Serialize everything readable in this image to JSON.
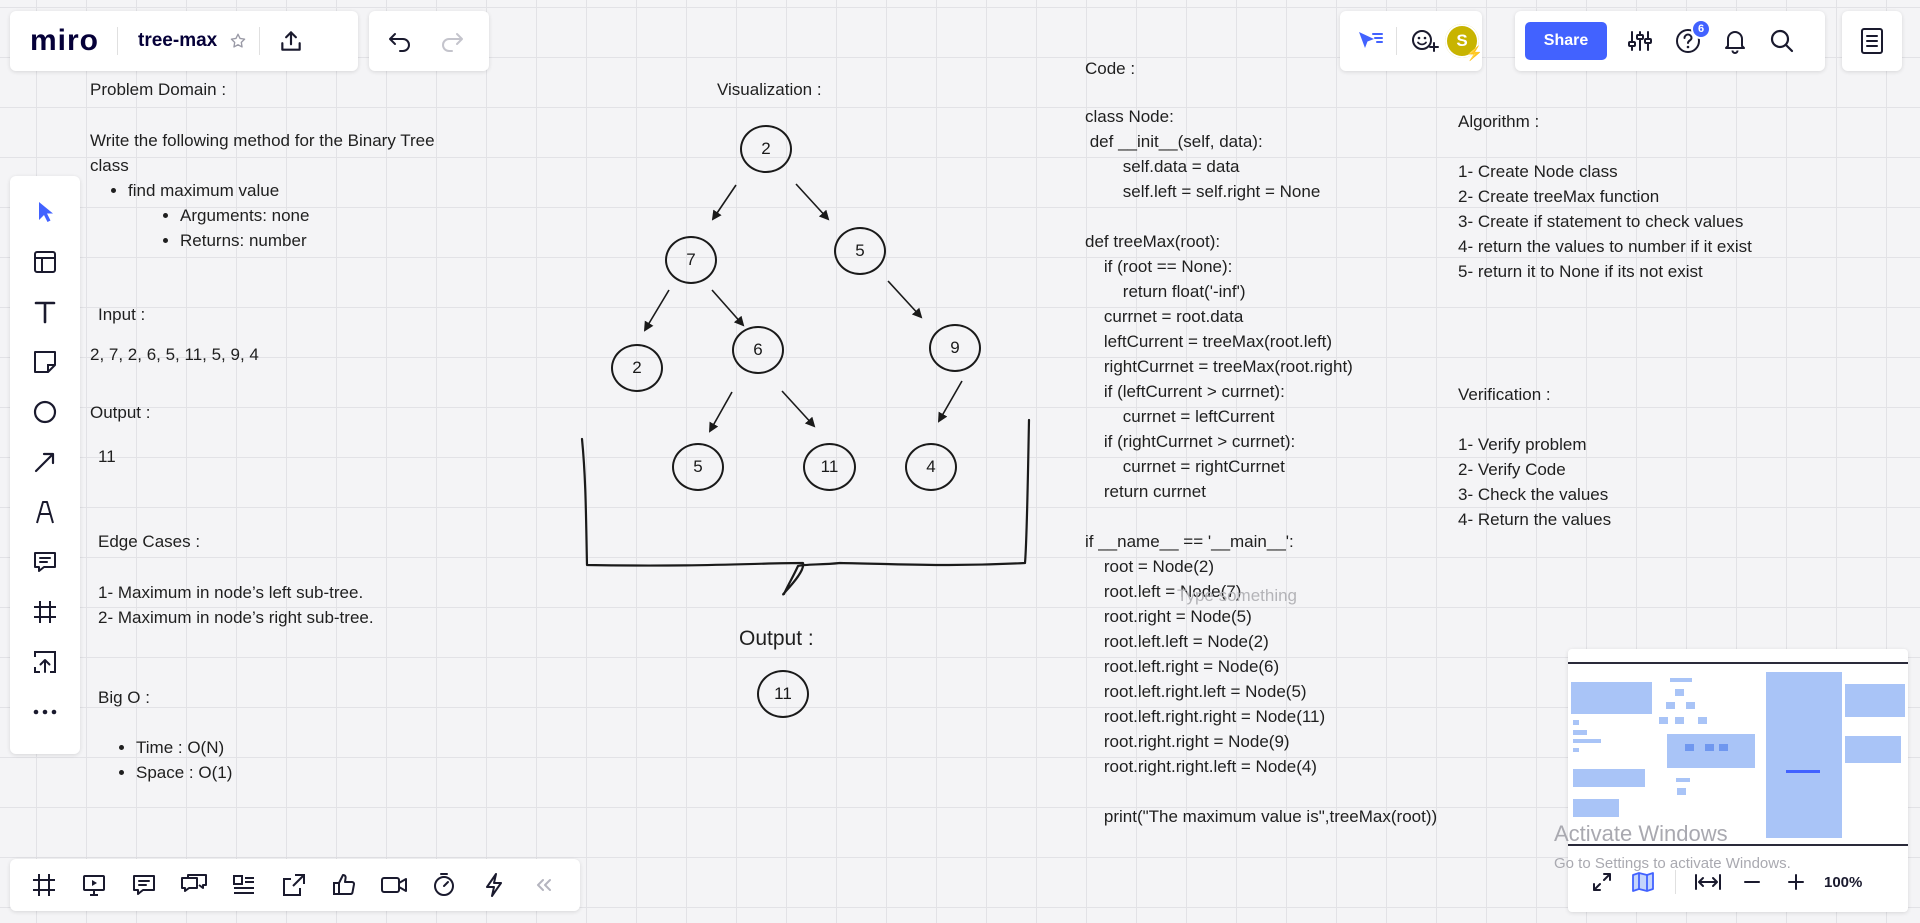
{
  "app": {
    "logo": "miro",
    "board_title": "tree-max",
    "star_icon": "star-outline-icon",
    "share_label": "Share",
    "notification_count": "6",
    "avatar_initial": "S",
    "accent_color": "#4262ff",
    "avatar_color": "#c8b400"
  },
  "problem": {
    "heading": "Problem Domain :",
    "desc_line1": "Write the following method for the Binary Tree",
    "desc_line2": "class",
    "bullet": "find maximum value",
    "sub_bullets": [
      "Arguments: none",
      "Returns: number"
    ],
    "input_heading": "Input :",
    "input_value": "2, 7, 2, 6, 5, 11, 5, 9, 4",
    "output_heading": "Output :",
    "output_value": "11",
    "edge_heading": "Edge Cases :",
    "edge_cases": [
      "1- Maximum in node’s left sub-tree.",
      "2- Maximum in node’s right sub-tree."
    ],
    "bigo_heading": "Big O :",
    "bigo_items": [
      "Time : O(N)",
      "Space : O(1)"
    ]
  },
  "visual": {
    "heading": "Visualization :",
    "nodes": [
      "2",
      "7",
      "5",
      "2",
      "6",
      "9",
      "5",
      "11",
      "4"
    ],
    "output_heading": "Output :",
    "output_value": "11"
  },
  "code": {
    "heading": "Code :",
    "lines": [
      "class Node:",
      " def __init__(self, data):",
      "        self.data = data",
      "        self.left = self.right = None",
      "",
      "def treeMax(root):",
      "    if (root == None):",
      "        return float('-inf')",
      "    currnet = root.data",
      "    leftCurrent = treeMax(root.left)",
      "    rightCurrnet = treeMax(root.right)",
      "    if (leftCurrent > currnet):",
      "        currnet = leftCurrent",
      "    if (rightCurrnet > currnet):",
      "        currnet = rightCurrnet",
      "    return currnet",
      "",
      "if __name__ == '__main__':",
      "    root = Node(2)",
      "    root.left = Node(7)",
      "    root.right = Node(5)",
      "    root.left.left = Node(2)",
      "    root.left.right = Node(6)",
      "    root.left.right.left = Node(5)",
      "    root.left.right.right = Node(11)",
      "    root.right.right = Node(9)",
      "    root.right.right.left = Node(4)",
      "",
      "    print(\"The maximum value is\",treeMax(root))"
    ],
    "ghost_text": "Type something"
  },
  "algorithm": {
    "heading": "Algorithm :",
    "steps": [
      "1- Create Node class",
      "2- Create treeMax function",
      "3- Create if statement to check values",
      "4- return the values to number if it exist",
      "5- return it to None if its not exist"
    ]
  },
  "verification": {
    "heading": "Verification :",
    "steps": [
      "1- Verify problem",
      "2- Verify Code",
      "3- Check the values",
      "4- Return the values"
    ]
  },
  "minimap": {
    "zoom": "100%"
  },
  "watermark": {
    "title": "Activate Windows",
    "subtitle": "Go to Settings to activate Windows."
  }
}
